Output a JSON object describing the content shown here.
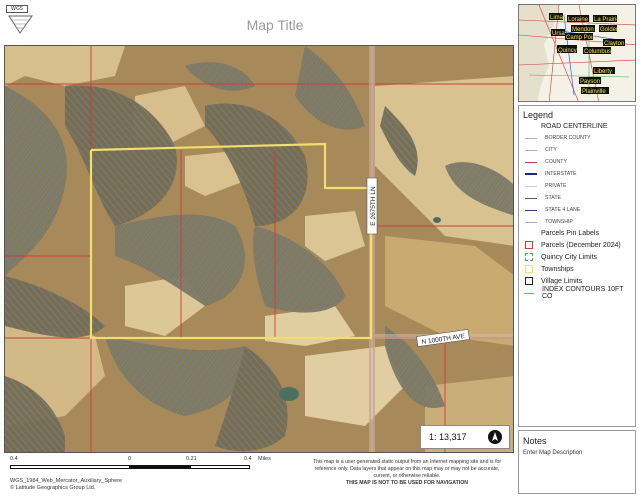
{
  "header": {
    "logo_text": "WGS",
    "title": "Map Title"
  },
  "map": {
    "road_labels": [
      "E 2675TH LN",
      "N 1000TH AVE"
    ],
    "colors": {
      "terrain": "#a88a5a",
      "field": "#d8c290",
      "contour": "#3f8fd6",
      "parcel": "#d23a3a",
      "township": "#f0e06a"
    }
  },
  "legend": {
    "title": "Legend",
    "road_centerline": {
      "label": "ROAD CENTERLINE",
      "items": [
        {
          "label": "BORDER COUNTY",
          "color": "#b0b0b0"
        },
        {
          "label": "CITY",
          "color": "#b0b0b0"
        },
        {
          "label": "COUNTY",
          "color": "#c04040"
        },
        {
          "label": "INTERSTATE",
          "color": "#1a2a80"
        },
        {
          "label": "PRIVATE",
          "color": "#cccccc"
        },
        {
          "label": "STATE",
          "color": "#555588"
        },
        {
          "label": "STATE 4 LANE",
          "color": "#3a3a8a"
        },
        {
          "label": "TOWNSHIP",
          "color": "#aaaaaa"
        }
      ]
    },
    "parcels_pin_labels": "Parcels Pin Labels",
    "items": [
      {
        "label": "Parcels (December 2024)",
        "color": "#d23a3a",
        "kind": "box"
      },
      {
        "label": "Quincy City Limits",
        "color": "#39b54a",
        "kind": "dashed"
      },
      {
        "label": "Townships",
        "color": "#f0e06a",
        "kind": "box"
      },
      {
        "label": "Village Limits",
        "color": "#222222",
        "kind": "box"
      },
      {
        "label": "INDEX CONTOURS 10FT CO",
        "color": "#5aa3e0",
        "kind": "line"
      }
    ]
  },
  "inset": {
    "labels": [
      "Lima",
      "Loraine",
      "La Prairie",
      "Ursa",
      "Mendon",
      "Golden",
      "Camp Point",
      "Clayton",
      "Quincy",
      "Columbus",
      "Liberty",
      "Payson",
      "Plainville"
    ]
  },
  "notes": {
    "title": "Notes",
    "text": "Enter Map Description"
  },
  "scale": {
    "ratio": "1: 13,317",
    "labels": [
      "0.4",
      "0",
      "0.21",
      "0.4"
    ],
    "unit": "Miles"
  },
  "credits": {
    "line1": "WGS_1984_Web_Mercator_Auxiliary_Sphere",
    "line2": "© Latitude Geographics Group Ltd."
  },
  "disclaimer": {
    "line1": "This map is a user generated static output from an Internet mapping site and is for",
    "line2": "reference only. Data layers that appear on this map may or may not be accurate,",
    "line3": "current, or otherwise reliable.",
    "line4": "THIS MAP IS NOT TO BE USED FOR NAVIGATION"
  }
}
